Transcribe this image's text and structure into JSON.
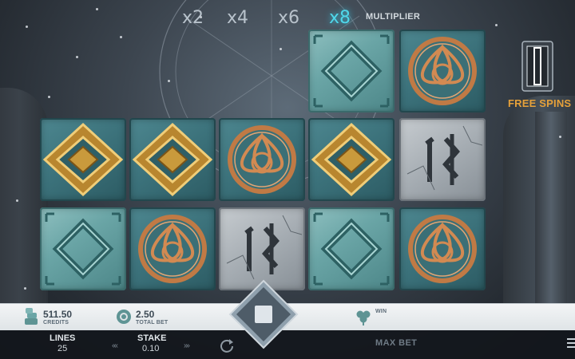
{
  "multiplier": {
    "values": [
      "x2",
      "x4",
      "x6",
      "x8"
    ],
    "active_index": 3,
    "label": "MULTIPLIER"
  },
  "free_spins": {
    "label": "FREE SPINS",
    "icon": "rune-pillar-icon"
  },
  "reels": {
    "rows": [
      [
        "",
        "",
        "",
        "teal-diamond",
        "celtic-knot"
      ],
      [
        "gold-diamond",
        "gold-diamond",
        "celtic-knot",
        "gold-diamond",
        "ten-rune"
      ],
      [
        "teal-diamond",
        "celtic-knot",
        "ten-rune",
        "teal-diamond",
        "celtic-knot"
      ]
    ]
  },
  "status_bar": {
    "credits": {
      "value": "511.50",
      "label": "CREDITS",
      "icon": "coins-icon"
    },
    "total_bet": {
      "value": "2.50",
      "label": "TOTAL BET",
      "icon": "chip-icon"
    },
    "win": {
      "value": "",
      "label": "WIN",
      "icon": "clover-icon"
    }
  },
  "controls": {
    "lines_label": "LINES",
    "lines_value": "25",
    "stake_label": "STAKE",
    "stake_value": "0.10",
    "max_bet_label": "MAX BET",
    "spin_icon": "stop-square-icon",
    "autoplay_icon": "refresh-icon",
    "menu_icon": "hamburger-icon"
  },
  "colors": {
    "accent_cyan": "#4fd7ea",
    "free_spins_orange": "#e6a13a",
    "gold": "#d7a94a",
    "copper": "#c07a45"
  }
}
